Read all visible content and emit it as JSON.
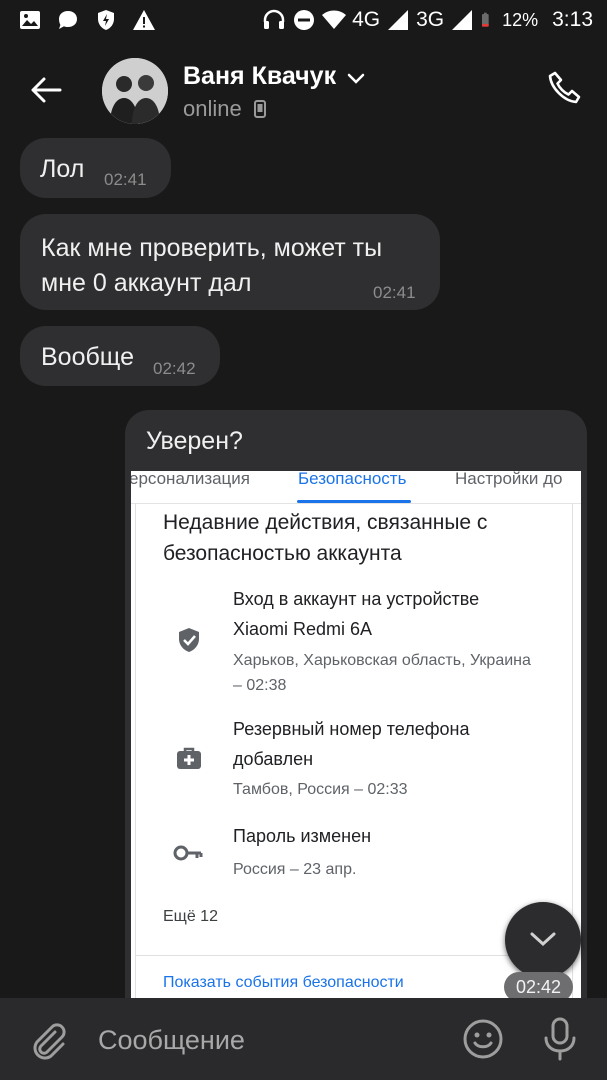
{
  "status_bar": {
    "network_4g": "4G",
    "network_3g": "3G",
    "battery_percent": "12%",
    "time": "3:13",
    "icons": [
      "gallery-icon",
      "chat-icon",
      "shield-icon",
      "warning-icon",
      "headphones-icon",
      "dnd-icon",
      "wifi-icon",
      "signal-icon",
      "battery-icon"
    ]
  },
  "header": {
    "contact_name": "Ваня Квачук",
    "status": "online"
  },
  "messages": [
    {
      "text": "Лол",
      "time": "02:41"
    },
    {
      "text": "Как мне проверить, может ты мне 0 аккаунт дал",
      "time": "02:41"
    },
    {
      "text": "Вообще",
      "time": "02:42"
    }
  ],
  "image_message": {
    "caption": "Уверен?",
    "time": "02:42",
    "screenshot": {
      "tabs": [
        "ерсонализация",
        "Безопасность",
        "Настройки до"
      ],
      "active_tab": "Безопасность",
      "section_title": "Недавние действия, связанные с безопасностью аккаунта",
      "events": [
        {
          "title": "Вход в аккаунт на устройстве Xiaomi Redmi 6A",
          "subtitle": "Харьков, Харьковская область, Украина – 02:38",
          "icon": "shield-icon"
        },
        {
          "title": "Резервный номер телефона добавлен",
          "subtitle": "Тамбов, Россия – 02:33",
          "icon": "medkit-icon"
        },
        {
          "title": "Пароль изменен",
          "subtitle": "Россия – 23 апр.",
          "icon": "key-icon"
        }
      ],
      "more_label": "Ещё 12",
      "link_label": "Показать события безопасности"
    }
  },
  "composer": {
    "placeholder": "Сообщение"
  },
  "colors": {
    "background": "#19191a",
    "bubble": "#2f2f31",
    "link_blue": "#1a73e8"
  }
}
